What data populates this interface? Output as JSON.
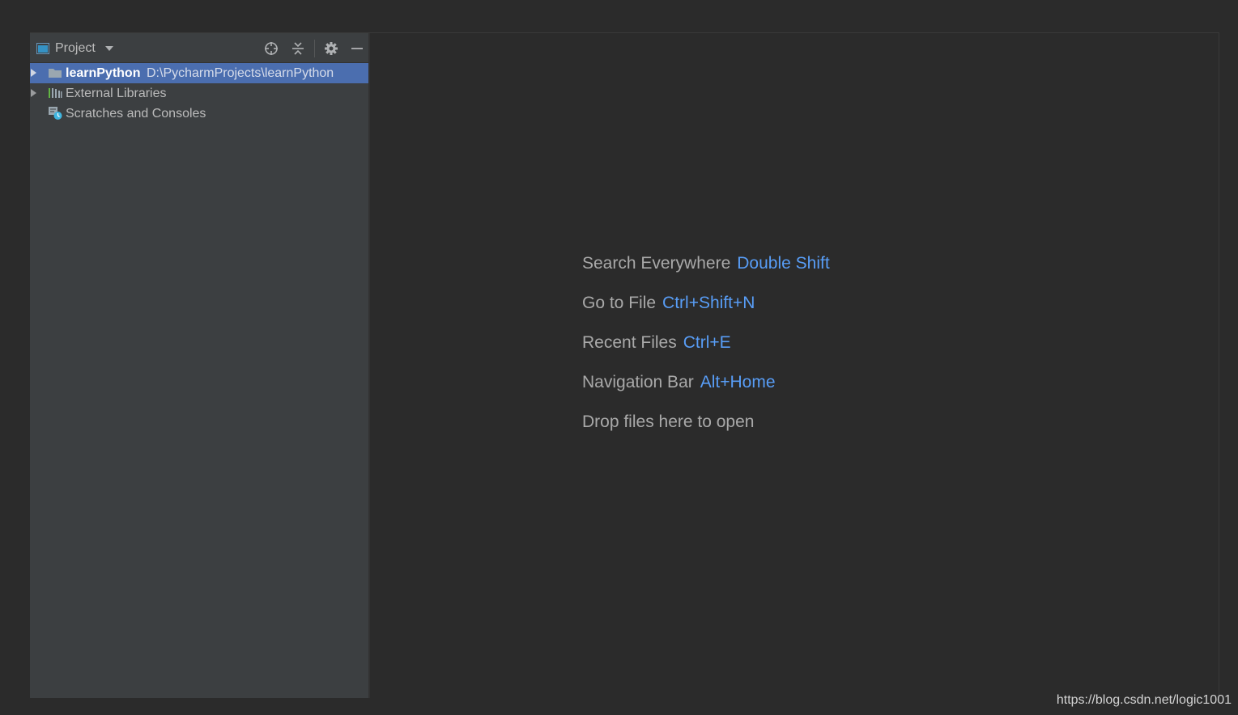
{
  "project_panel": {
    "title": "Project",
    "title_icon": "project-window-icon",
    "header_buttons": [
      "locate-icon",
      "collapse-all-icon",
      "gear-icon",
      "minimize-icon"
    ],
    "tree": [
      {
        "label": "learnPython",
        "path": "D:\\PycharmProjects\\learnPython",
        "icon": "folder-icon",
        "selected": true,
        "expandable": true
      },
      {
        "label": "External Libraries",
        "icon": "libraries-icon",
        "selected": false,
        "expandable": true
      },
      {
        "label": "Scratches and Consoles",
        "icon": "scratches-icon",
        "selected": false,
        "expandable": false
      }
    ]
  },
  "editor": {
    "hints": [
      {
        "label": "Search Everywhere",
        "shortcut": "Double Shift"
      },
      {
        "label": "Go to File",
        "shortcut": "Ctrl+Shift+N"
      },
      {
        "label": "Recent Files",
        "shortcut": "Ctrl+E"
      },
      {
        "label": "Navigation Bar",
        "shortcut": "Alt+Home"
      },
      {
        "label": "Drop files here to open",
        "shortcut": ""
      }
    ]
  },
  "watermark": "https://blog.csdn.net/logic1001",
  "colors": {
    "panel_bg": "#3c3f41",
    "editor_bg": "#2b2b2b",
    "selection": "#4b6eaf",
    "shortcut_accent": "#589df6",
    "hint_text": "#a9a9a9"
  }
}
